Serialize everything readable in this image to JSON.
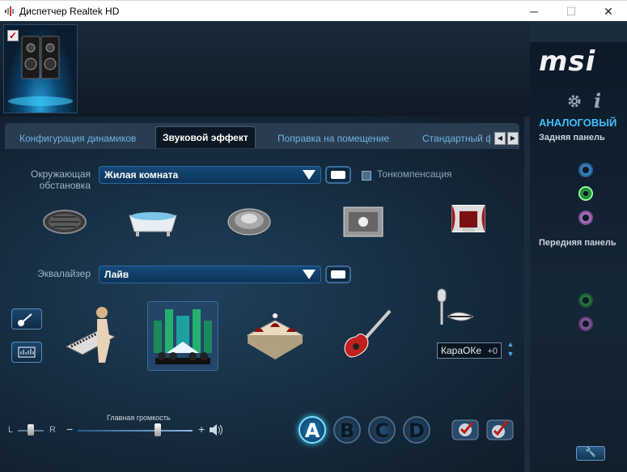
{
  "window": {
    "title": "Диспетчер Realtek HD"
  },
  "brand": {
    "logo": "msi"
  },
  "tabs": [
    {
      "label": "Конфигурация динамиков",
      "active": false
    },
    {
      "label": "Звуковой эффект",
      "active": true
    },
    {
      "label": "Поправка на помещение",
      "active": false
    },
    {
      "label": "Стандартный ф",
      "active": false
    }
  ],
  "environment": {
    "label_line1": "Окружающая",
    "label_line2": "обстановка",
    "selected": "Жилая комната",
    "loudness_label": "Тонкомпенсация",
    "loudness_checked": false,
    "presets": [
      "manhole-icon",
      "bathtub-icon",
      "stone-disc-icon",
      "box-room-icon",
      "theater-icon"
    ]
  },
  "equalizer": {
    "label": "Эквалайзер",
    "selected": "Лайв",
    "presets": [
      "pop-icon",
      "live-icon",
      "club-icon",
      "rock-icon"
    ],
    "karaoke": {
      "label": "КараОКе",
      "value": "+0"
    }
  },
  "volume": {
    "label": "Главная громкость",
    "left": "L",
    "right": "R",
    "minus": "−",
    "plus": "+",
    "level": 0.7,
    "balance": 0.5
  },
  "quick_buttons": [
    "A",
    "B",
    "C",
    "D"
  ],
  "right_panel": {
    "section": "АНАЛОГОВЫЙ",
    "rear": "Задняя панель",
    "front": "Передняя панель"
  },
  "colors": {
    "accent": "#2aa0d8",
    "jack_blue": "#3b8fd0",
    "jack_green": "#2ea84a",
    "jack_pink": "#b07ac8"
  }
}
